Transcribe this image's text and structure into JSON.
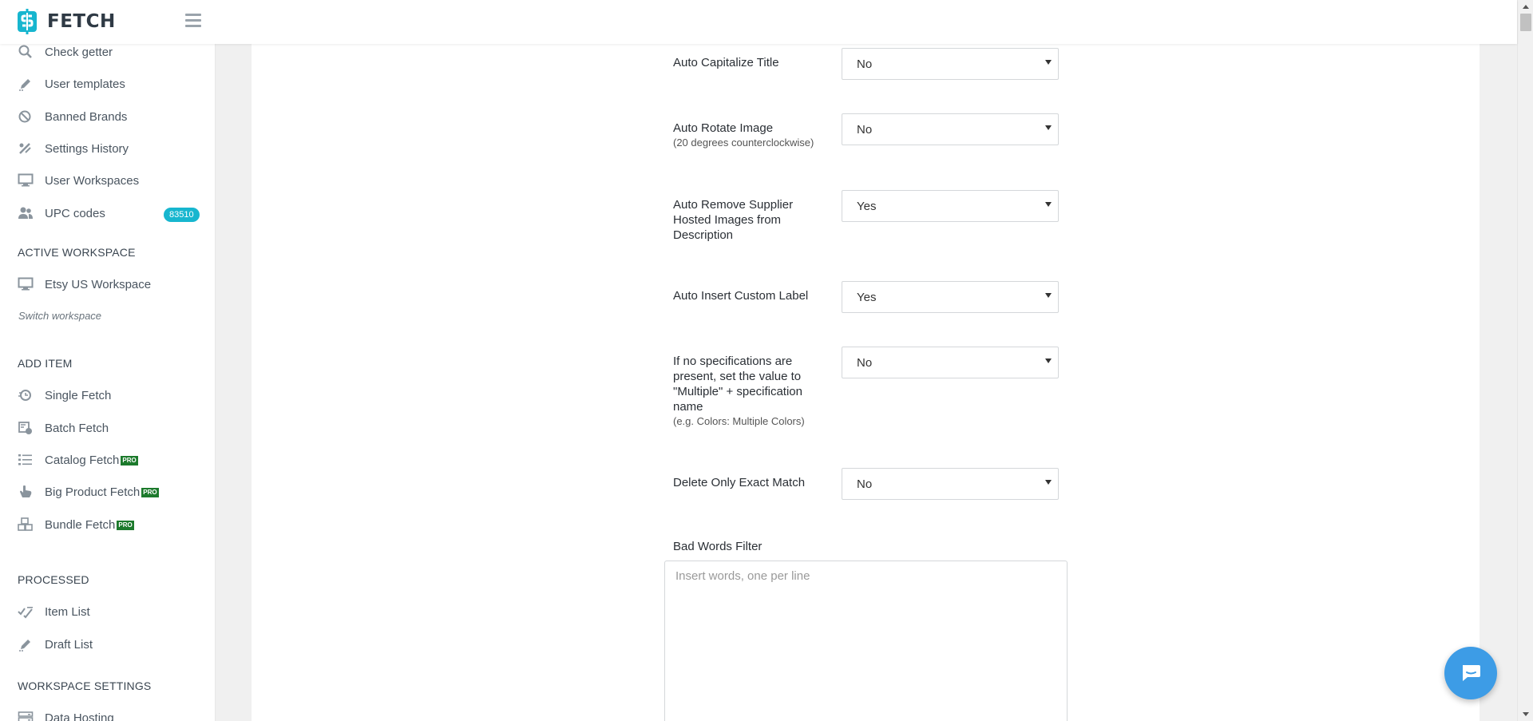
{
  "app": {
    "logo_text": "FETCH",
    "brand_color": "#17b6cf"
  },
  "sidebar": {
    "items_top": [
      {
        "label": "Check getter",
        "icon": "search-icon"
      },
      {
        "label": "User templates",
        "icon": "pencil-icon"
      },
      {
        "label": "Banned Brands",
        "icon": "banned-icon"
      },
      {
        "label": "Settings History",
        "icon": "history-icon"
      },
      {
        "label": "User Workspaces",
        "icon": "monitor-icon"
      },
      {
        "label": "UPC codes",
        "icon": "users-icon",
        "badge": "83510"
      }
    ],
    "active_workspace": {
      "title": "ACTIVE WORKSPACE",
      "item": {
        "label": "Etsy US Workspace",
        "icon": "monitor-icon"
      },
      "switch_label": "Switch workspace"
    },
    "add_item": {
      "title": "ADD ITEM",
      "items": [
        {
          "label": "Single Fetch",
          "icon": "single-fetch-icon"
        },
        {
          "label": "Batch Fetch",
          "icon": "batch-fetch-icon"
        },
        {
          "label": "Catalog Fetch",
          "icon": "list-icon",
          "pro": "PRO"
        },
        {
          "label": "Big Product Fetch",
          "icon": "hand-icon",
          "pro": "PRO"
        },
        {
          "label": "Bundle Fetch",
          "icon": "boxes-icon",
          "pro": "PRO"
        }
      ]
    },
    "processed": {
      "title": "PROCESSED",
      "items": [
        {
          "label": "Item List",
          "icon": "checklist-icon"
        },
        {
          "label": "Draft List",
          "icon": "pencil-icon"
        }
      ]
    },
    "workspace_settings": {
      "title": "WORKSPACE SETTINGS",
      "items": [
        {
          "label": "Data Hosting",
          "icon": "server-icon"
        }
      ]
    }
  },
  "settings": [
    {
      "label": "Auto Capitalize Title",
      "sub": "",
      "value": "No"
    },
    {
      "label": "Auto Rotate Image",
      "sub": "(20 degrees counterclockwise)",
      "value": "No"
    },
    {
      "label": "Auto Remove Supplier Hosted Images from Description",
      "sub": "",
      "value": "Yes"
    },
    {
      "label": "Auto Insert Custom Label",
      "sub": "",
      "value": "Yes"
    },
    {
      "label": "If no specifications are present, set the value to \"Multiple\" + specification name",
      "sub": "(e.g. Colors: Multiple Colors)",
      "value": "No"
    },
    {
      "label": "Delete Only Exact Match",
      "sub": "",
      "value": "No"
    }
  ],
  "bad_words": {
    "label": "Bad Words Filter",
    "placeholder": "Insert words, one per line",
    "value": ""
  },
  "chat": {
    "icon": "chat-icon"
  }
}
